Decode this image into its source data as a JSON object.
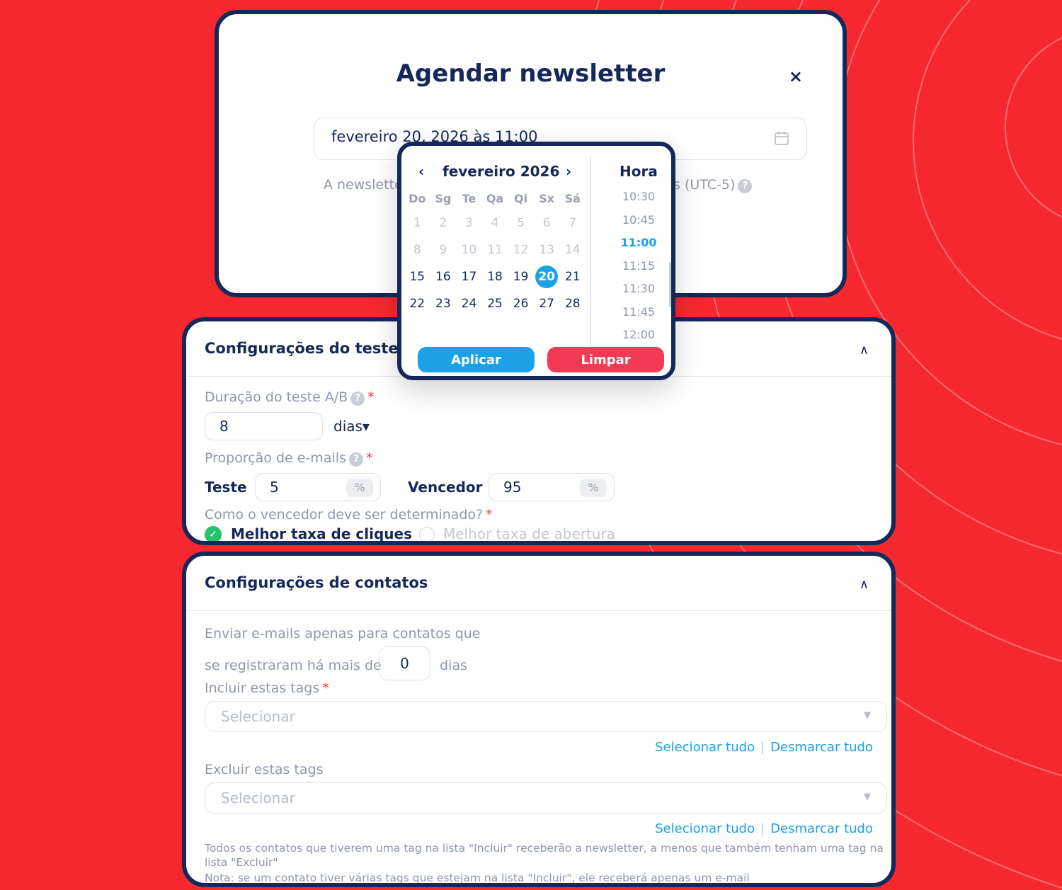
{
  "modal": {
    "title": "Agendar newsletter",
    "close_icon": "×",
    "date_value": "fevereiro 20, 2026 às 11:00",
    "tz_note_start": "A newslette",
    "tz_note_end": "s (UTC-5)",
    "help_glyph": "?"
  },
  "picker": {
    "month_label": "fevereiro 2026",
    "prev": "‹",
    "next": "›",
    "weekdays": [
      "Do",
      "Sg",
      "Te",
      "Qa",
      "Qi",
      "Sx",
      "Sá"
    ],
    "weeks": [
      [
        "1",
        "2",
        "3",
        "4",
        "5",
        "6",
        "7"
      ],
      [
        "8",
        "9",
        "10",
        "11",
        "12",
        "13",
        "14"
      ],
      [
        "15",
        "16",
        "17",
        "18",
        "19",
        "20",
        "21"
      ],
      [
        "22",
        "23",
        "24",
        "25",
        "26",
        "27",
        "28"
      ]
    ],
    "selected_day": "20",
    "hora_label": "Hora",
    "times": [
      "10:30",
      "10:45",
      "11:00",
      "11:15",
      "11:30",
      "11:45",
      "12:00"
    ],
    "selected_time": "11:00",
    "apply_label": "Aplicar",
    "clear_label": "Limpar"
  },
  "ab_section": {
    "title": "Configurações do teste A/B",
    "toggle": "∧",
    "duration_label": "Duração do teste A/B",
    "required_mark": "*",
    "duration_value": "8",
    "duration_unit": "dias▾",
    "ratio_label": "Proporção de e-mails",
    "test_label": "Teste",
    "test_value": "5",
    "winner_label": "Vencedor",
    "winner_value": "95",
    "percent": "%",
    "winner_question": "Como o vencedor deve ser determinado?",
    "option_clicks": "Melhor taxa de cliques",
    "option_opens": "Melhor taxa de abertura",
    "check_glyph": "✓"
  },
  "contacts_section": {
    "title": "Configurações de contatos",
    "toggle": "∧",
    "send_line1": "Enviar e-mails apenas para contatos que",
    "send_line2": "se registraram há mais de",
    "days_value": "0",
    "days_unit": "dias",
    "include_label": "Incluir estas tags",
    "exclude_label": "Excluir estas tags",
    "select_placeholder": "Selecionar",
    "select_all": "Selecionar tudo",
    "deselect_all": "Desmarcar tudo",
    "separator": "|",
    "note1": "Todos os contatos que tiverem uma tag na lista \"Incluir\" receberão a newsletter, a menos que também tenham uma tag na lista \"Excluir\"",
    "note2": "Nota: se um contato tiver várias tags que estejam na lista \"Incluir\", ele receberá apenas um e-mail"
  },
  "colors": {
    "background": "#f5282f",
    "navy": "#15285a",
    "accent_blue": "#1ba1e8",
    "danger": "#f23a55",
    "success": "#24c26a"
  }
}
